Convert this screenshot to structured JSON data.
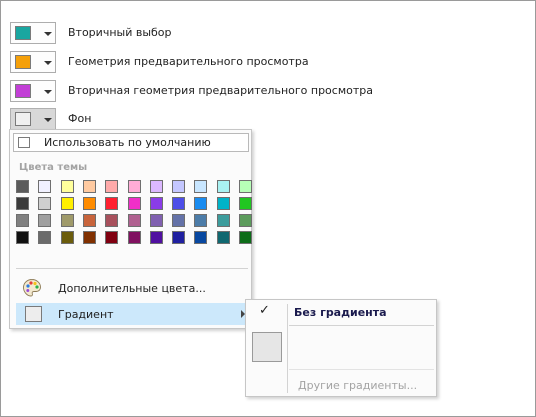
{
  "rows": [
    {
      "label": "Вторичный выбор",
      "color": "#1aa6a0"
    },
    {
      "label": "Геометрия предварительного просмотра",
      "color": "#f5a00a"
    },
    {
      "label": "Вторичная геометрия предварительного просмотра",
      "color": "#c23fd6"
    },
    {
      "label": "Фон",
      "color": "#f0f0f0"
    }
  ],
  "dropdown": {
    "default_label": "Использовать по умолчанию",
    "theme_header": "Цвета темы",
    "theme_colors": [
      [
        "#5b5b5b",
        "#f1f1ff",
        "#ffff9c",
        "#ffcaa1",
        "#ffaaaa",
        "#ffacd6",
        "#dbb8ff",
        "#c4c7ff",
        "#c8e6ff",
        "#a9f2f2",
        "#b7ffb7"
      ],
      [
        "#3b3b3b",
        "#cfcfcf",
        "#ffef00",
        "#ff8c00",
        "#ff2030",
        "#f02fc8",
        "#8a3ce8",
        "#4d4ee8",
        "#1a8cf0",
        "#00b3c8",
        "#21c621"
      ],
      [
        "#808080",
        "#9f9f9f",
        "#9f9a6a",
        "#c8643c",
        "#a8505c",
        "#b06090",
        "#8060b0",
        "#6472a8",
        "#4c7ca8",
        "#3c9c9c",
        "#5c9c5c"
      ],
      [
        "#101010",
        "#6b6b6b",
        "#6b5c0c",
        "#803000",
        "#800010",
        "#801060",
        "#5010a0",
        "#2020a0",
        "#0848a0",
        "#106870",
        "#0c6c18"
      ]
    ],
    "more_colors_label": "Дополнительные цвета...",
    "more_colors_icon": "palette-icon",
    "gradient_label": "Градиент"
  },
  "submenu": {
    "check_mark": "✓",
    "no_gradient_label": "Без градиента",
    "more_gradients_label": "Другие градиенты..."
  }
}
